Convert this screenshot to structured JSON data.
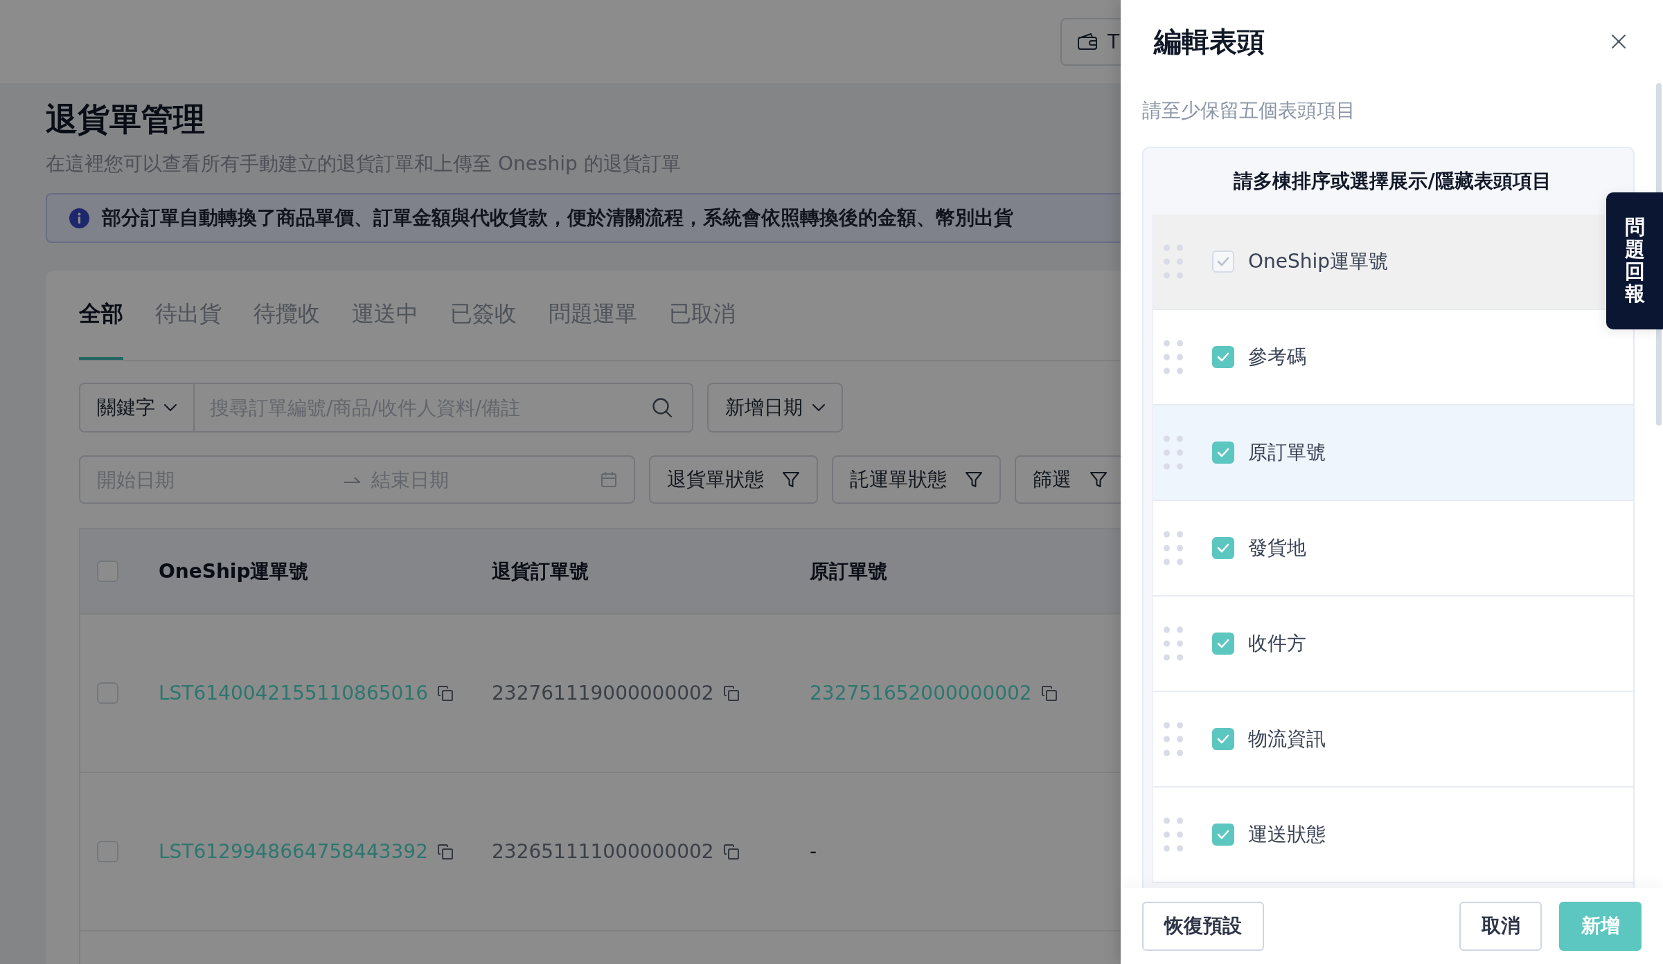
{
  "top_bar": {
    "button_label": "T"
  },
  "page": {
    "title": "退貨單管理",
    "subtitle": "在這裡您可以查看所有手動建立的退貨訂單和上傳至 Oneship 的退貨訂單",
    "notice": "部分訂單自動轉換了商品單價、訂單金額與代收貨款，便於清關流程，系統會依照轉換後的金額、幣別出貨"
  },
  "tabs": [
    {
      "label": "全部",
      "selected": true
    },
    {
      "label": "待出貨",
      "selected": false
    },
    {
      "label": "待攬收",
      "selected": false
    },
    {
      "label": "運送中",
      "selected": false
    },
    {
      "label": "已簽收",
      "selected": false
    },
    {
      "label": "問題運單",
      "selected": false
    },
    {
      "label": "已取消",
      "selected": false
    }
  ],
  "filters": {
    "keyword_select": "關鍵字",
    "search": {
      "placeholder": "搜尋訂單編號/商品/收件人資料/備註"
    },
    "date_type_select": "新增日期",
    "date_range": {
      "start_placeholder": "開始日期",
      "end_placeholder": "結束日期"
    },
    "buttons": [
      "退貨單狀態",
      "託運單狀態",
      "篩選"
    ]
  },
  "table": {
    "select_all": {
      "checked": false
    },
    "columns": [
      "OneShip運單號",
      "退貨訂單號",
      "原訂單號"
    ],
    "rows": [
      {
        "checked": false,
        "cells": [
          {
            "text": "LST6140042155110865016",
            "kind": "link",
            "copyable": true
          },
          {
            "text": "232761119000000002",
            "kind": "text",
            "copyable": true
          },
          {
            "text": "232751652000000002",
            "kind": "link",
            "copyable": true
          }
        ]
      },
      {
        "checked": false,
        "cells": [
          {
            "text": "LST6129948664758443392",
            "kind": "link",
            "copyable": true
          },
          {
            "text": "232651111000000002",
            "kind": "text",
            "copyable": true
          },
          {
            "text": "-",
            "kind": "text",
            "copyable": false
          }
        ]
      }
    ]
  },
  "drawer": {
    "title": "編輯表頭",
    "hint": "請至少保留五個表頭項目",
    "list_title": "請多棟排序或選擇展示/隱藏表頭項目",
    "items": [
      {
        "label": "OneShip運單號",
        "checked": true,
        "disabled": true,
        "highlighted": false
      },
      {
        "label": "參考碼",
        "checked": true,
        "disabled": false,
        "highlighted": false
      },
      {
        "label": "原訂單號",
        "checked": true,
        "disabled": false,
        "highlighted": true
      },
      {
        "label": "發貨地",
        "checked": true,
        "disabled": false,
        "highlighted": false
      },
      {
        "label": "收件方",
        "checked": true,
        "disabled": false,
        "highlighted": false
      },
      {
        "label": "物流資訊",
        "checked": true,
        "disabled": false,
        "highlighted": false
      },
      {
        "label": "運送狀態",
        "checked": true,
        "disabled": false,
        "highlighted": false
      }
    ],
    "buttons": {
      "reset": "恢復預設",
      "cancel": "取消",
      "confirm": "新增"
    }
  },
  "feedback_tab": {
    "label": "問題回報"
  }
}
